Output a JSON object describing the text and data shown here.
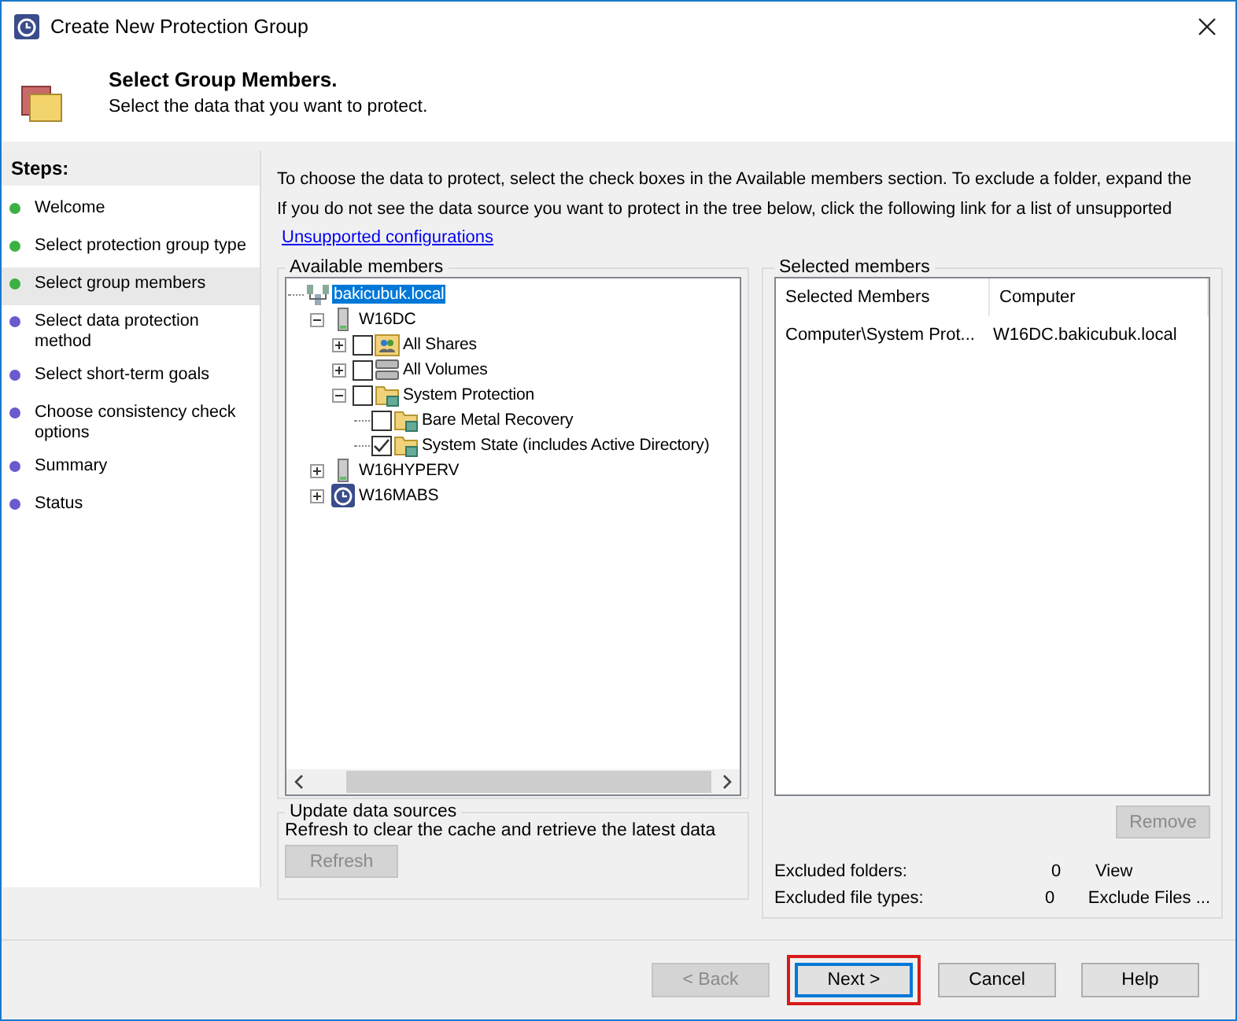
{
  "window": {
    "title": "Create New Protection Group"
  },
  "header": {
    "title": "Select Group Members.",
    "subtitle": "Select the data that you want to protect."
  },
  "steps": {
    "title": "Steps:",
    "items": [
      {
        "label": "Welcome",
        "color": "#3cb043",
        "selected": false
      },
      {
        "label": "Select protection group type",
        "color": "#3cb043",
        "selected": false
      },
      {
        "label": "Select group members",
        "color": "#3cb043",
        "selected": true
      },
      {
        "label": "Select data protection method",
        "color": "#6a5acd",
        "selected": false
      },
      {
        "label": "Select short-term goals",
        "color": "#6a5acd",
        "selected": false
      },
      {
        "label": "Choose consistency check options",
        "color": "#6a5acd",
        "selected": false
      },
      {
        "label": "Summary",
        "color": "#6a5acd",
        "selected": false
      },
      {
        "label": "Status",
        "color": "#6a5acd",
        "selected": false
      }
    ]
  },
  "intro": [
    "To choose the data to protect, select the check boxes in the Available members section. To exclude a folder, expand the",
    "If you do not see the data source you want to protect in the tree below, click the following link for a list of unsupported"
  ],
  "link": "Unsupported configurations",
  "available": {
    "title": "Available members",
    "tree": [
      {
        "label": "bakicubuk.local",
        "kind": "domain",
        "selected": true,
        "children": [
          {
            "label": "W16DC",
            "kind": "server",
            "expanded": true,
            "selected": false,
            "children": [
              {
                "label": "All Shares",
                "kind": "shares",
                "expanded": false,
                "checked": false,
                "selected": false
              },
              {
                "label": "All Volumes",
                "kind": "volumes",
                "expanded": false,
                "checked": false,
                "selected": false
              },
              {
                "label": "System Protection",
                "kind": "folder",
                "expanded": true,
                "checked": false,
                "selected": false,
                "children": [
                  {
                    "label": "Bare Metal Recovery",
                    "kind": "folder",
                    "checked": false,
                    "selected": false
                  },
                  {
                    "label": "System State (includes Active Directory)",
                    "kind": "folder",
                    "checked": true,
                    "selected": false
                  }
                ]
              }
            ]
          },
          {
            "label": "W16HYPERV",
            "kind": "server",
            "expanded": false,
            "selected": false
          },
          {
            "label": "W16MABS",
            "kind": "backup",
            "expanded": false,
            "selected": false
          }
        ]
      }
    ]
  },
  "update": {
    "title": "Update data sources",
    "text": "Refresh to clear the cache and retrieve the latest data",
    "button": {
      "label": "Refresh",
      "disabled": true
    }
  },
  "selected": {
    "title": "Selected members",
    "columns": [
      "Selected Members",
      "Computer"
    ],
    "rows": [
      [
        "Computer\\System  Prot...",
        "W16DC.bakicubuk.local"
      ]
    ],
    "remove": {
      "label": "Remove",
      "disabled": true
    },
    "excluded": [
      {
        "label": "Excluded folders:",
        "count": "0",
        "action": "View"
      },
      {
        "label": "Excluded file types:",
        "count": "0",
        "action": "Exclude Files ..."
      }
    ]
  },
  "buttons": [
    {
      "label": "< Back",
      "disabled": true,
      "highlighted": false
    },
    {
      "label": "Next >",
      "disabled": false,
      "highlighted": true
    },
    {
      "label": "Cancel",
      "disabled": false,
      "highlighted": false
    },
    {
      "label": "Help",
      "disabled": false,
      "highlighted": false
    }
  ]
}
